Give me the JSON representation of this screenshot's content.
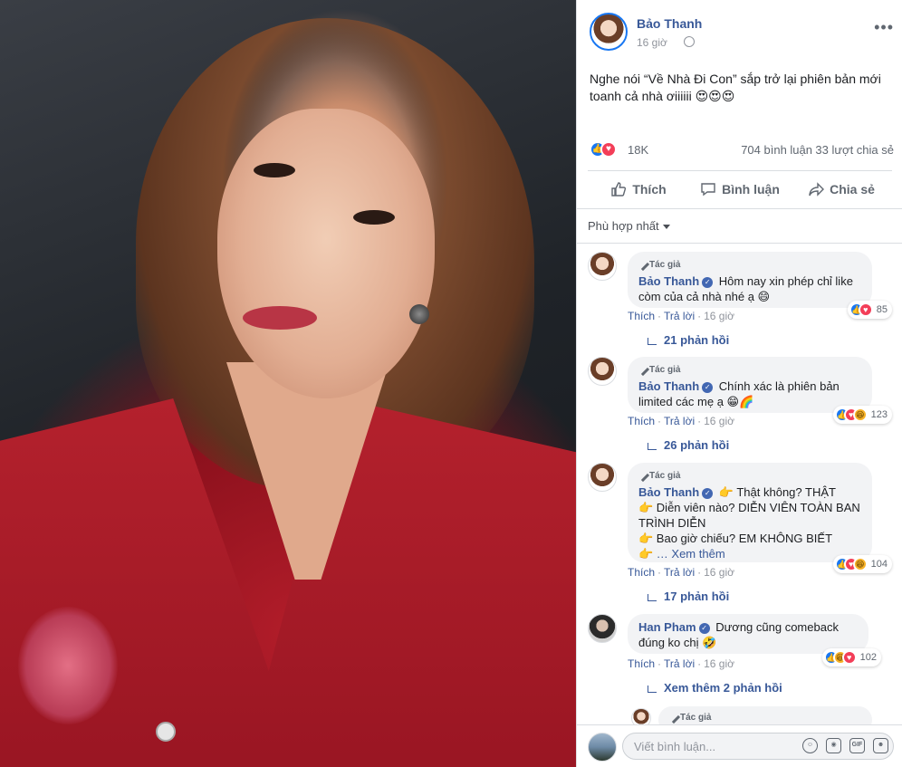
{
  "post": {
    "author": "Bảo Thanh",
    "time": "16 giờ",
    "text": "Nghe nói “Về Nhà Đi Con” sắp trở lại phiên bản mới toanh cả nhà ơiiiiii 😍😍😍",
    "reactions": "18K",
    "comments": "704 bình luận",
    "shares": "33 lượt chia sẻ",
    "actions": {
      "like": "Thích",
      "comment": "Bình luận",
      "share": "Chia sẻ"
    },
    "sort": "Phù hợp nhất"
  },
  "comments": [
    {
      "badge": "Tác giả",
      "name": "Bảo Thanh",
      "text": "Hôm nay xin phép chỉ like còm của cả nhà nhé ạ 😄",
      "reacts": "85",
      "like": "Thích",
      "reply": "Trả lời",
      "time": "16 giờ",
      "replies": "21 phản hồi"
    },
    {
      "badge": "Tác giả",
      "name": "Bảo Thanh",
      "text": "Chính xác là phiên bản limited các mẹ ạ 😁🌈",
      "reacts": "123",
      "like": "Thích",
      "reply": "Trả lời",
      "time": "16 giờ",
      "replies": "26 phản hồi"
    },
    {
      "badge": "Tác giả",
      "name": "Bảo Thanh",
      "lines": [
        "👉 Thật không? THẬT",
        "👉 Diễn viên nào? DIỄN VIÊN TOÀN BAN TRÌNH DIỄN",
        "👉 Bao giờ chiếu? EM KHÔNG BIẾT",
        "👉 … Xem thêm"
      ],
      "reacts": "104",
      "like": "Thích",
      "reply": "Trả lời",
      "time": "16 giờ",
      "replies": "17 phản hồi"
    },
    {
      "name": "Han Pham",
      "text": "Dương cũng comeback đúng ko chị 🤣",
      "reacts": "102",
      "like": "Thích",
      "reply": "Trả lời",
      "time": "16 giờ",
      "replies": "Xem thêm 2 phản hồi"
    },
    {
      "badge": "Tác giả"
    }
  ],
  "composer": {
    "placeholder": "Viết bình luận...",
    "icons": [
      "emoji-icon",
      "camera-icon",
      "gif-icon",
      "sticker-icon"
    ],
    "gif_label": "GIF"
  },
  "colors": {
    "link": "#385898",
    "like": "#1877f2",
    "love": "#f33e58",
    "haha": "#f7b125"
  }
}
